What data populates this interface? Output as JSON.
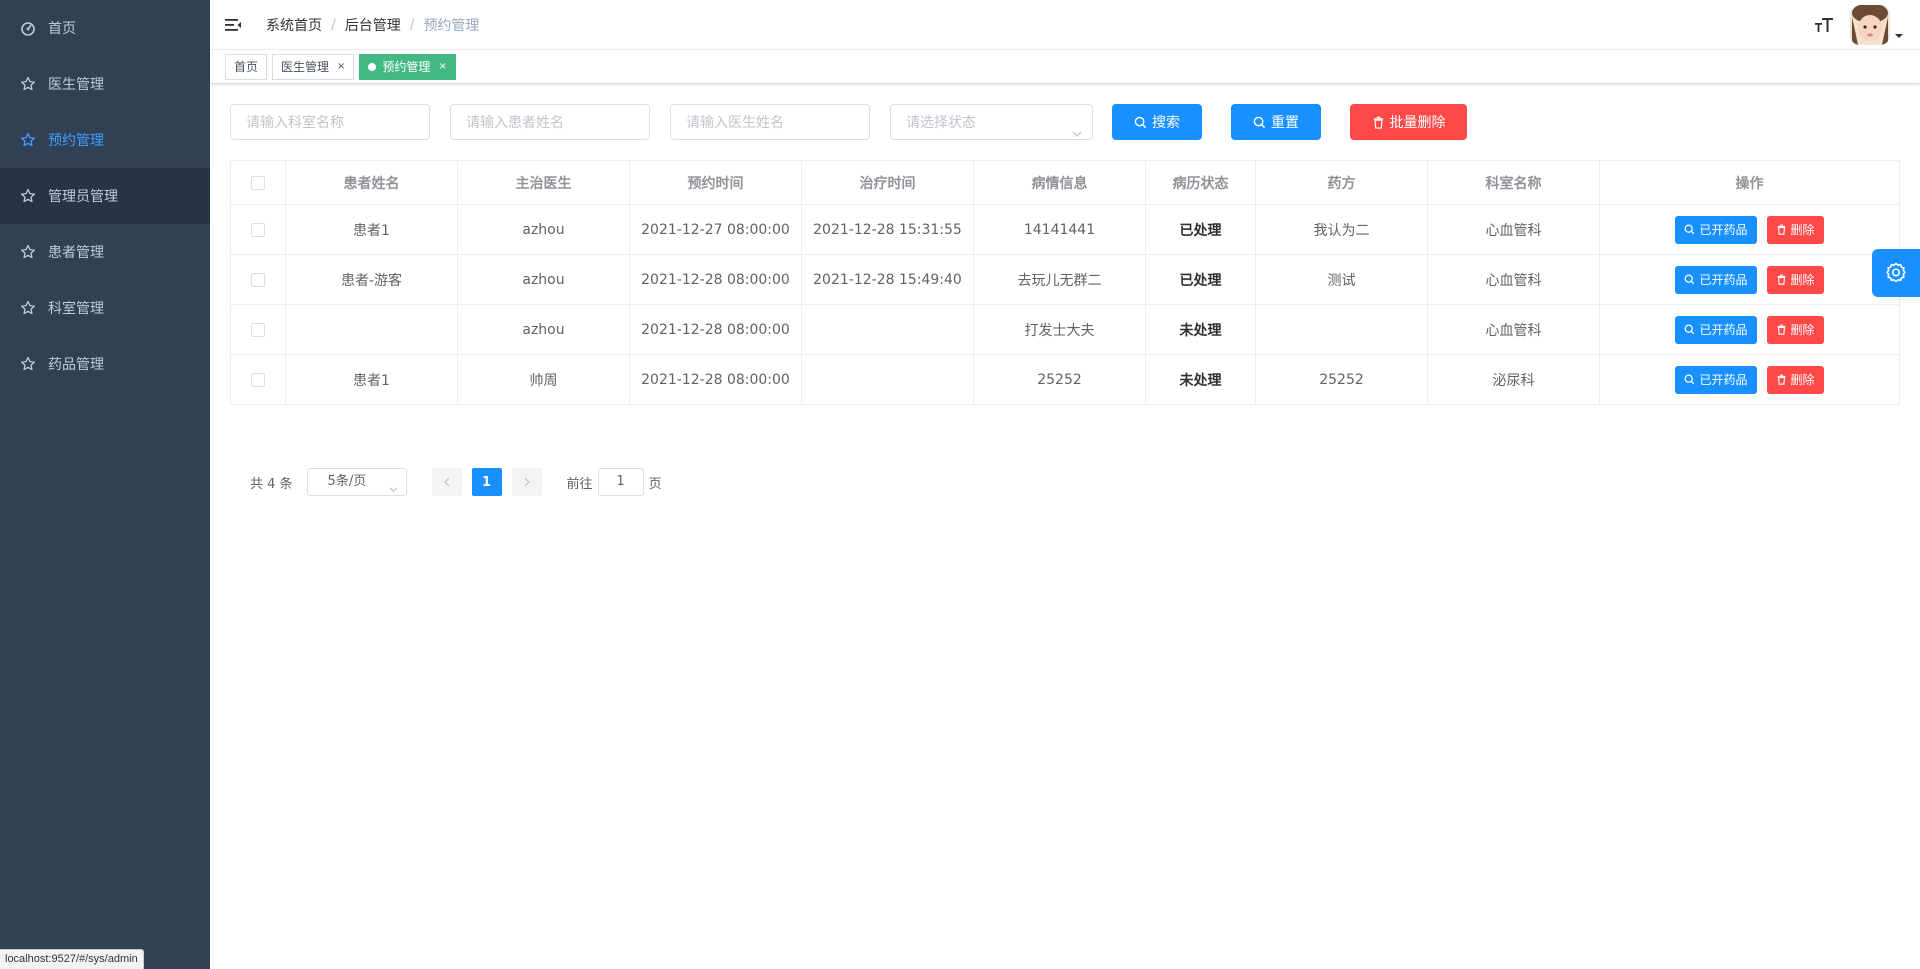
{
  "sidebar": {
    "items": [
      {
        "label": "首页",
        "icon": "dashboard-icon"
      },
      {
        "label": "医生管理",
        "icon": "star-icon"
      },
      {
        "label": "预约管理",
        "icon": "star-icon"
      },
      {
        "label": "管理员管理",
        "icon": "star-icon"
      },
      {
        "label": "患者管理",
        "icon": "star-icon"
      },
      {
        "label": "科室管理",
        "icon": "star-icon"
      },
      {
        "label": "药品管理",
        "icon": "star-icon"
      }
    ]
  },
  "navbar": {
    "breadcrumb": [
      "系统首页",
      "后台管理",
      "预约管理"
    ]
  },
  "tags": [
    {
      "label": "首页"
    },
    {
      "label": "医生管理",
      "close": "×"
    },
    {
      "label": "预约管理",
      "close": "×"
    }
  ],
  "filters": {
    "dept_placeholder": "请输入科室名称",
    "patient_placeholder": "请输入患者姓名",
    "doctor_placeholder": "请输入医生姓名",
    "status_placeholder": "请选择状态",
    "search_label": "搜索",
    "reset_label": "重置",
    "batch_delete_label": "批量删除"
  },
  "table": {
    "headers": [
      "患者姓名",
      "主治医生",
      "预约时间",
      "治疗时间",
      "病情信息",
      "病历状态",
      "药方",
      "科室名称",
      "操作"
    ],
    "rows": [
      {
        "patient": "患者1",
        "doctor": "azhou",
        "appt": "2021-12-27 08:00:00",
        "treat": "2021-12-28 15:31:55",
        "info": "14141441",
        "status": "已处理",
        "rx": "我认为二",
        "dept": "心血管科"
      },
      {
        "patient": "患者-游客",
        "doctor": "azhou",
        "appt": "2021-12-28 08:00:00",
        "treat": "2021-12-28 15:49:40",
        "info": "去玩儿无群二",
        "status": "已处理",
        "rx": "测试",
        "dept": "心血管科"
      },
      {
        "patient": "",
        "doctor": "azhou",
        "appt": "2021-12-28 08:00:00",
        "treat": "",
        "info": "打发士大夫",
        "status": "未处理",
        "rx": "",
        "dept": "心血管科"
      },
      {
        "patient": "患者1",
        "doctor": "帅周",
        "appt": "2021-12-28 08:00:00",
        "treat": "",
        "info": "25252",
        "status": "未处理",
        "rx": "25252",
        "dept": "泌尿科"
      }
    ],
    "op_open_label": "已开药品",
    "op_delete_label": "删除"
  },
  "pagination": {
    "total": "共 4 条",
    "page_size": "5条/页",
    "current": "1",
    "goto_prefix": "前往",
    "goto_value": "1",
    "goto_suffix": "页"
  },
  "statusbar": {
    "url": "localhost:9527/#/sys/admin"
  },
  "colors": {
    "sidebar_bg": "#304156",
    "accent": "#1890ff",
    "danger": "#ff4949",
    "active_tag": "#42b983"
  }
}
